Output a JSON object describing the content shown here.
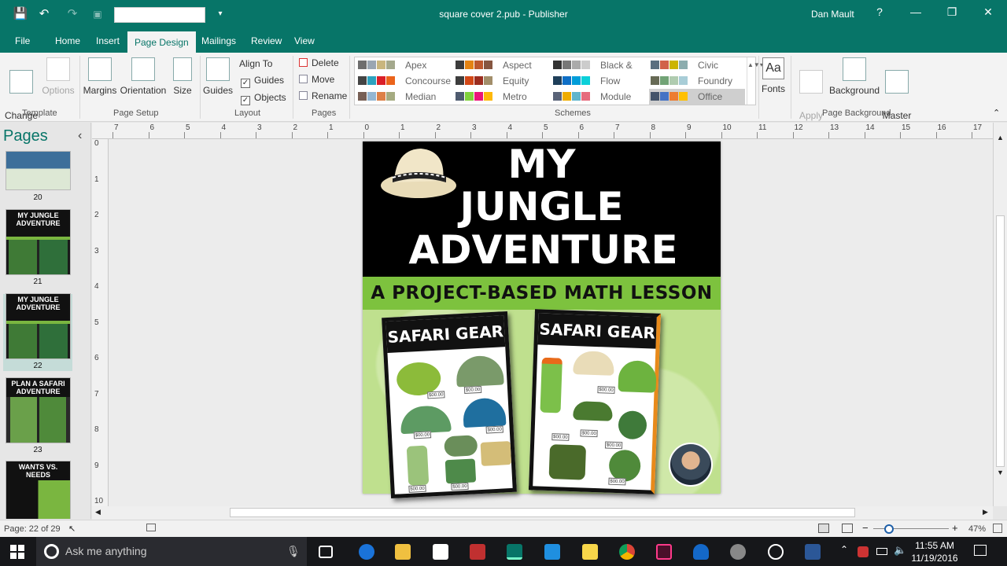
{
  "window": {
    "title": "square cover 2.pub  -  Publisher",
    "user": "Dan Mault",
    "help": "?",
    "minimize": "—",
    "restore": "❐",
    "close": "✕"
  },
  "quick_access": {
    "save": "💾",
    "undo": "↶",
    "redo": "↷",
    "more": "▾"
  },
  "tabs": [
    "File",
    "Home",
    "Insert",
    "Page Design",
    "Mailings",
    "Review",
    "View"
  ],
  "ribbon": {
    "template": {
      "change_template": "Change\nTemplate",
      "options": "Options",
      "group": "Template"
    },
    "page_setup": {
      "margins": "Margins",
      "orientation": "Orientation",
      "size": "Size",
      "group": "Page Setup"
    },
    "layout": {
      "guides": "Guides",
      "align_to": "Align To",
      "guides_check": "Guides",
      "objects_check": "Objects",
      "group": "Layout"
    },
    "pages": {
      "delete": "Delete",
      "move": "Move",
      "rename": "Rename",
      "group": "Pages"
    },
    "schemes": {
      "group": "Schemes",
      "items": [
        {
          "name": "Apex",
          "colors": [
            "#6e6e6e",
            "#9aa6b2",
            "#c9b67e",
            "#a4a98d"
          ]
        },
        {
          "name": "Aspect",
          "colors": [
            "#3c3c3c",
            "#e48312",
            "#bd582c",
            "#865640"
          ]
        },
        {
          "name": "Black & G...",
          "colors": [
            "#333333",
            "#777777",
            "#aaaaaa",
            "#cccccc"
          ]
        },
        {
          "name": "Civic",
          "colors": [
            "#5a6e7f",
            "#d16349",
            "#ccb400",
            "#8cadae"
          ]
        },
        {
          "name": "Concourse",
          "colors": [
            "#444444",
            "#2da2bf",
            "#da1f28",
            "#eb641b"
          ]
        },
        {
          "name": "Equity",
          "colors": [
            "#3d3d3d",
            "#d34817",
            "#9b2d1f",
            "#a28e6a"
          ]
        },
        {
          "name": "Flow",
          "colors": [
            "#1f3f5a",
            "#0f6fc6",
            "#009dd9",
            "#0bd0d9"
          ]
        },
        {
          "name": "Foundry",
          "colors": [
            "#676a55",
            "#72a376",
            "#b0ccb0",
            "#a8cdd7"
          ]
        },
        {
          "name": "Median",
          "colors": [
            "#775f55",
            "#94b6d2",
            "#dd8047",
            "#a5ab81"
          ]
        },
        {
          "name": "Metro",
          "colors": [
            "#4e5b6f",
            "#7fd13b",
            "#ea157a",
            "#feb80a"
          ]
        },
        {
          "name": "Module",
          "colors": [
            "#5a6378",
            "#f0ad00",
            "#60b5cc",
            "#e66c7d"
          ]
        },
        {
          "name": "Office",
          "colors": [
            "#44546a",
            "#4472c4",
            "#ed7d31",
            "#ffc000"
          ]
        }
      ]
    },
    "fonts": {
      "label": "Fonts",
      "icon_text": "Aa"
    },
    "background": {
      "apply_image": "Apply\nImage",
      "background": "Background",
      "master_pages": "Master\nPages",
      "group": "Page Background"
    }
  },
  "pages_pane": {
    "title": "Pages",
    "collapse": "‹",
    "thumbnails": [
      {
        "number": "20",
        "lines": ""
      },
      {
        "number": "21",
        "lines": "MY JUNGLE ADVENTURE"
      },
      {
        "number": "22",
        "lines": "MY JUNGLE ADVENTURE"
      },
      {
        "number": "23",
        "lines": "PLAN A SAFARI ADVENTURE"
      },
      {
        "number": "",
        "lines": "WANTS VS. NEEDS"
      }
    ]
  },
  "ruler_top": [
    "7",
    "6",
    "5",
    "4",
    "3",
    "2",
    "1",
    "0",
    "1",
    "2",
    "3",
    "4",
    "5",
    "6",
    "7",
    "8",
    "9",
    "10",
    "11",
    "12",
    "13",
    "14",
    "15",
    "16",
    "17"
  ],
  "ruler_left": [
    "0",
    "1",
    "2",
    "3",
    "4",
    "5",
    "6",
    "7",
    "8",
    "9",
    "10"
  ],
  "document": {
    "title_line1": "MY",
    "title_line2": "JUNGLE",
    "title_line3": "ADVENTURE",
    "subtitle": "A PROJECT-BASED MATH LESSON",
    "card_left": "SAFARI GEAR",
    "card_right": "SAFARI GEAR",
    "price": "$00.00"
  },
  "statusbar": {
    "page": "Page: 22 of 29",
    "zoom": "47%",
    "minus": "−",
    "plus": "+"
  },
  "taskbar": {
    "search": "Ask me anything",
    "time": "11:55 AM",
    "date": "11/19/2016"
  }
}
